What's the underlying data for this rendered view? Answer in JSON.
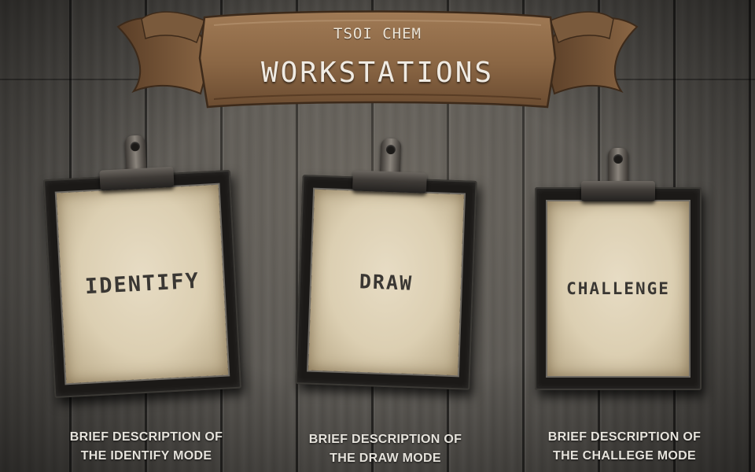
{
  "banner": {
    "subtitle": "TSOI CHEM",
    "title": "WORKSTATIONS"
  },
  "stations": [
    {
      "label": "IDENTIFY",
      "description_line1": "BRIEF DESCRIPTION OF",
      "description_line2": "THE IDENTIFY MODE"
    },
    {
      "label": "DRAW",
      "description_line1": "BRIEF DESCRIPTION OF",
      "description_line2": "THE DRAW MODE"
    },
    {
      "label": "CHALLENGE",
      "description_line1": "BRIEF DESCRIPTION OF",
      "description_line2": "THE CHALLEGE MODE"
    }
  ],
  "colors": {
    "wood": "#5c5954",
    "banner_leather": "#8c6a4a",
    "paper": "#dccfb2",
    "paper_text": "#3a3733",
    "description_text": "#e6e3dc"
  },
  "icons": {
    "banner": "leather-scroll-banner",
    "clip": "clipboard-clip-icon"
  }
}
